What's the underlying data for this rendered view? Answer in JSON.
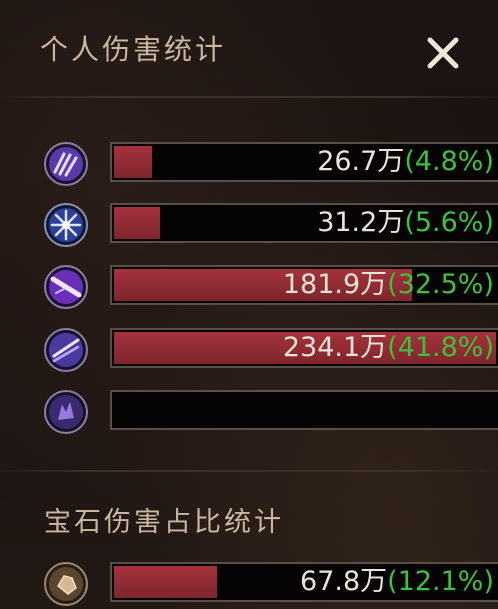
{
  "header": {
    "title": "个人伤害统计"
  },
  "skills": [
    {
      "icon": "claw-icon",
      "amount": "26.7万",
      "percent": "(4.8%)",
      "fill": 0.1
    },
    {
      "icon": "frost-burst-icon",
      "amount": "31.2万",
      "percent": "(5.6%)",
      "fill": 0.12
    },
    {
      "icon": "arcane-slash-icon",
      "amount": "181.9万",
      "percent": "(32.5%)",
      "fill": 0.78
    },
    {
      "icon": "wind-wave-icon",
      "amount": "234.1万",
      "percent": "(41.8%)",
      "fill": 1.0
    },
    {
      "icon": "shadow-hand-icon",
      "amount": "",
      "percent": "",
      "fill": 0
    }
  ],
  "gem_section": {
    "title": "宝石伤害占比统计",
    "rows": [
      {
        "icon": "gem-icon",
        "amount": "67.8万",
        "percent": "(12.1%)",
        "fill": 0.27
      }
    ]
  },
  "colors": {
    "bar_fill": "#9b2f38",
    "amount_text": "#e8e4d6",
    "percent_text": "#3ec23e",
    "title_text": "#c9b79f"
  }
}
